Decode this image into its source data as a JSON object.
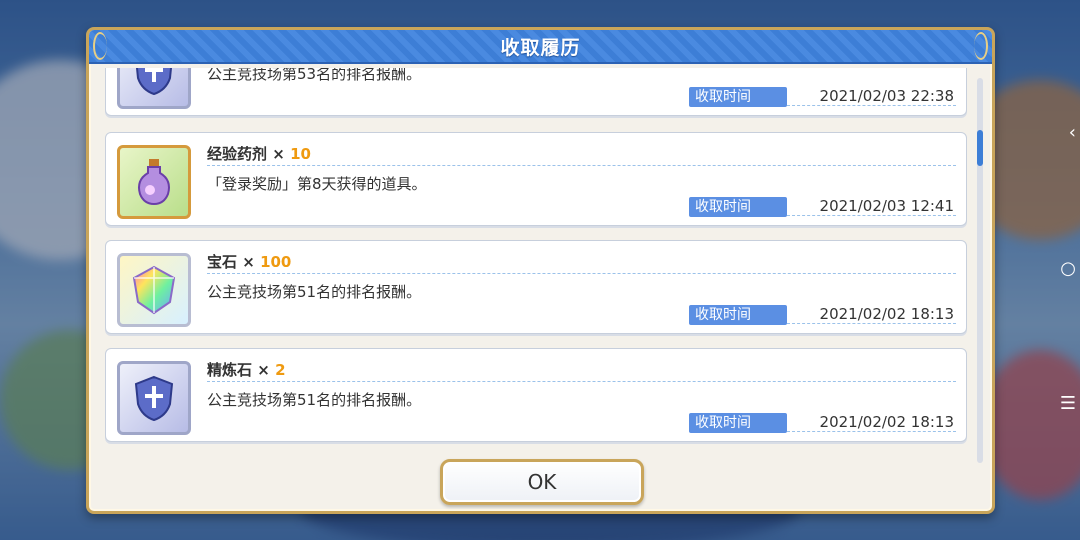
{
  "dialog": {
    "title": "收取履历",
    "ok_label": "OK"
  },
  "time_label": "收取时间",
  "entries": [
    {
      "icon": "shield-icon",
      "name": "",
      "qty": "",
      "desc": "公主竞技场第53名的排名报酬。",
      "time": "2021/02/03 22:38"
    },
    {
      "icon": "potion-icon",
      "name": "经验药剂",
      "qty": "10",
      "desc": "「登录奖励」第8天获得的道具。",
      "time": "2021/02/03 12:41"
    },
    {
      "icon": "gem-icon",
      "name": "宝石",
      "qty": "100",
      "desc": "公主竞技场第51名的排名报酬。",
      "time": "2021/02/02 18:13"
    },
    {
      "icon": "shield-icon",
      "name": "精炼石",
      "qty": "2",
      "desc": "公主竞技场第51名的排名报酬。",
      "time": "2021/02/02 18:13"
    }
  ],
  "times_sign": "×",
  "colors": {
    "header": "#3d7ed6",
    "qty": "#ef9a10",
    "badge": "#5b8fe3",
    "frame": "#c9a55a"
  },
  "side": {
    "back": "‹",
    "home": "○",
    "menu": "☰"
  }
}
